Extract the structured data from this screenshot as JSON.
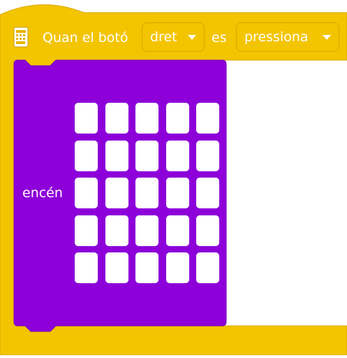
{
  "hat_block": {
    "text_when": "Quan el botó",
    "button_dropdown": "dret",
    "text_es": "es",
    "event_dropdown": "pressiona",
    "icon": "microbit-extension-icon",
    "color": "#f3c400"
  },
  "led_block": {
    "label": "encén",
    "color": "#8d00d9",
    "grid": [
      [
        false,
        false,
        false,
        false,
        false
      ],
      [
        false,
        false,
        false,
        false,
        false
      ],
      [
        false,
        false,
        false,
        false,
        false
      ],
      [
        false,
        false,
        false,
        false,
        false
      ],
      [
        false,
        false,
        false,
        false,
        false
      ]
    ]
  }
}
